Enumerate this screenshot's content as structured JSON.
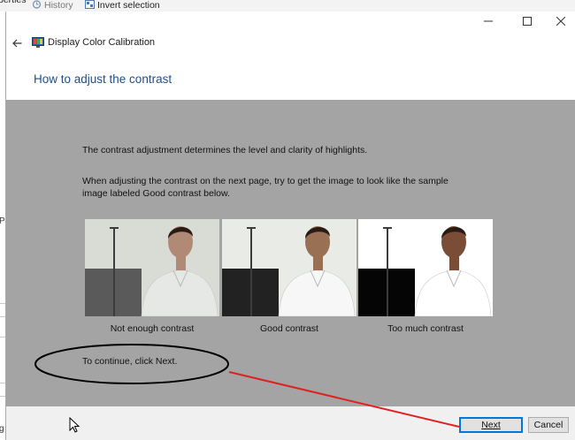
{
  "background_window": {
    "ribbon_cut_text": "perties",
    "ribbon_history": "History",
    "ribbon_invert": "Invert selection",
    "left_cut_text": "Pa",
    "bottom_cut_text": "g"
  },
  "window": {
    "app_title": "Display Color Calibration",
    "minimize_icon": "minimize-icon",
    "maximize_icon": "maximize-icon",
    "close_icon": "close-icon",
    "back_icon": "back-arrow-icon"
  },
  "page": {
    "heading": "How to adjust the contrast",
    "paragraph1": "The contrast adjustment determines the level and clarity of highlights.",
    "paragraph2_line1": "When adjusting the contrast on the next page, try to get the image to look like the sample",
    "paragraph2_line2": "image labeled Good contrast below.",
    "samples": [
      {
        "caption": "Not enough contrast",
        "wall": "#d9dcd4",
        "floor": "#5a5a5a",
        "shirt": "#e6e8e6",
        "skin": "#b08a74"
      },
      {
        "caption": "Good contrast",
        "wall": "#e9ebe6",
        "floor": "#222222",
        "shirt": "#f6f7f6",
        "skin": "#9a7055"
      },
      {
        "caption": "Too much contrast",
        "wall": "#ffffff",
        "floor": "#050505",
        "shirt": "#ffffff",
        "skin": "#7a4e36"
      }
    ],
    "continue_text": "To continue, click Next."
  },
  "footer": {
    "next_label": "Next",
    "cancel_label": "Cancel"
  },
  "annotation": {
    "color": "#e02020",
    "ellipse_color": "#000000"
  },
  "colors": {
    "heading": "#1d4f8c",
    "panel": "#a4a4a4",
    "accent": "#0078d7"
  }
}
